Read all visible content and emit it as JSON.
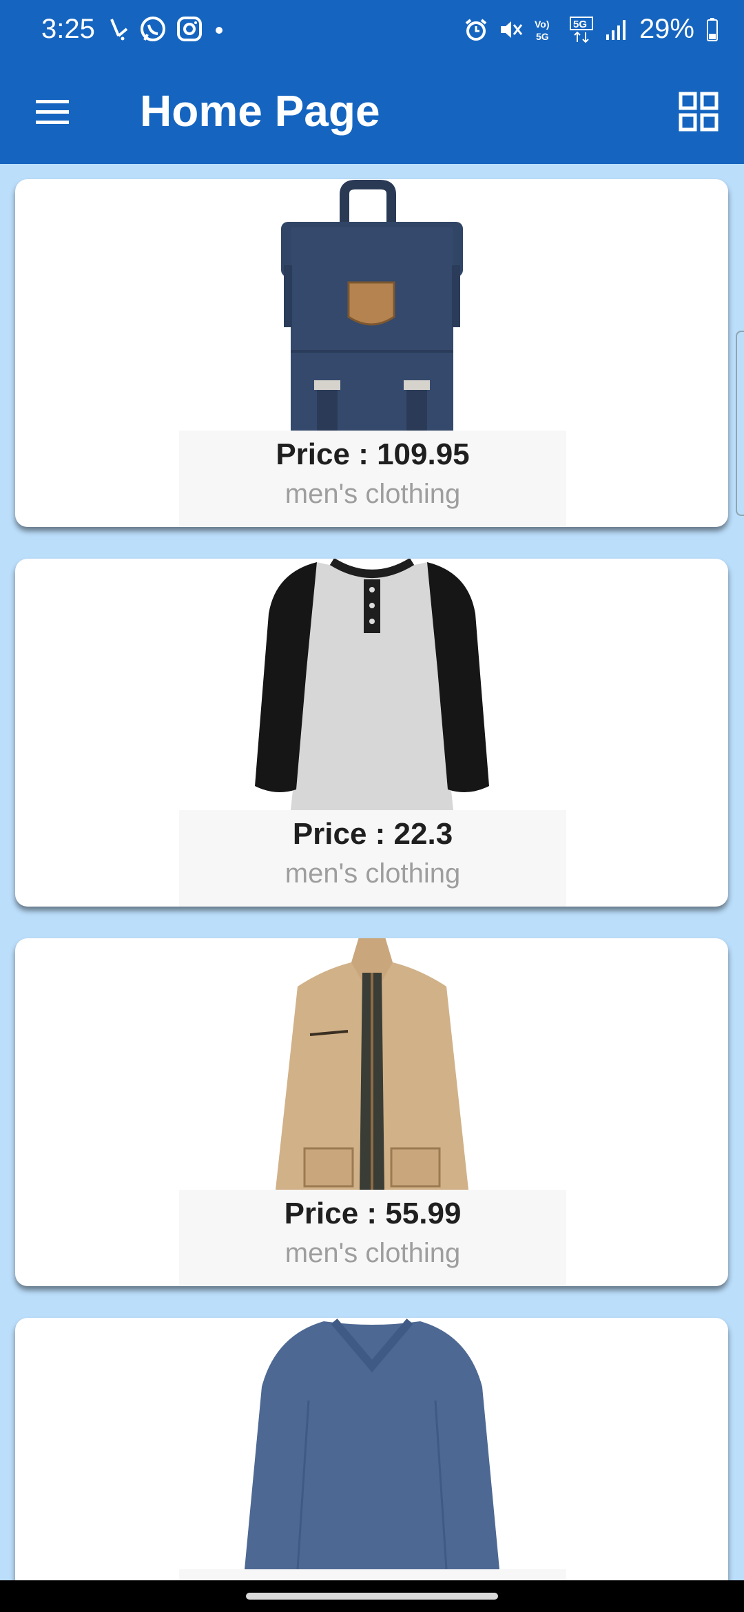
{
  "status_bar": {
    "time": "3:25",
    "battery": "29%",
    "left_icons": [
      "missed-call-icon",
      "whatsapp-icon",
      "instagram-icon",
      "dot-icon"
    ],
    "right_icons": [
      "alarm-icon",
      "mute-icon",
      "volte-icon",
      "5g-icon",
      "signal-icon",
      "battery-icon"
    ]
  },
  "app_bar": {
    "title": "Home Page",
    "menu_icon": "hamburger-menu-icon",
    "view_icon": "grid-view-icon",
    "color": "#1565c0"
  },
  "products": [
    {
      "price_label": "Price : 109.95",
      "category": "men's clothing",
      "image": "backpack"
    },
    {
      "price_label": "Price : 22.3",
      "category": "men's clothing",
      "image": "raglan-tshirt"
    },
    {
      "price_label": "Price : 55.99",
      "category": "men's clothing",
      "image": "cotton-jacket"
    },
    {
      "price_label": "",
      "category": "",
      "image": "long-sleeve-vneck"
    }
  ],
  "colors": {
    "background": "#bbdefb",
    "card": "#ffffff",
    "price_text": "#1f1f1f",
    "category_text": "#9e9e9e"
  }
}
